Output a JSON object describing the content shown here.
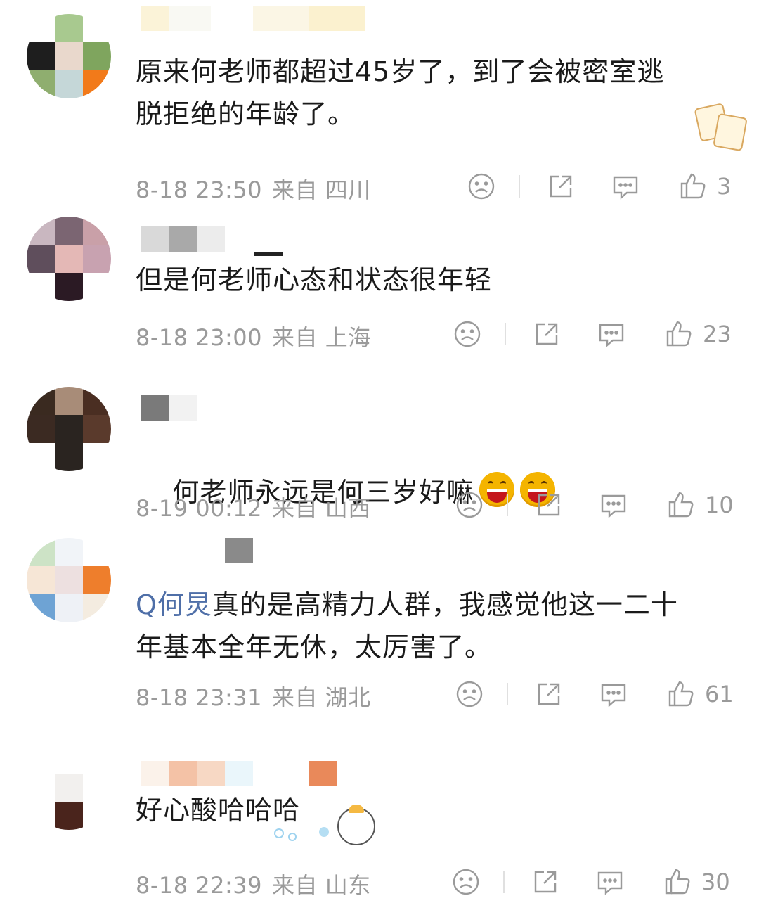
{
  "comments": [
    {
      "text": "原来何老师都超过45岁了，到了会被密室逃\n脱拒绝的年龄了。",
      "time": "8-18 23:50",
      "from": "来自 四川",
      "likes": "3"
    },
    {
      "text": "但是何老师心态和状态很年轻",
      "time": "8-18 23:00",
      "from": "来自 上海",
      "likes": "23"
    },
    {
      "text": "何老师永远是何三岁好嘛",
      "time": "8-19 00:12",
      "from": "来自 山西",
      "likes": "10"
    },
    {
      "mention": "Q何炅",
      "text": "真的是高精力人群，我感觉他这一二十\n年基本全年无休，太厉害了。",
      "time": "8-18 23:31",
      "from": "来自 湖北",
      "likes": "61"
    },
    {
      "text": "好心酸哈哈哈",
      "time": "8-18 22:39",
      "from": "来自 山东",
      "likes": "30"
    }
  ],
  "icons": [
    "dislike-icon",
    "share-icon",
    "reply-icon",
    "like-icon",
    "laugh-emoji",
    "fortune-mahjong-sticker",
    "cartoon-sticker"
  ],
  "colors": {
    "meta_text": "#9a9a9a",
    "mention": "#4f6fa8",
    "divider": "#ececec"
  }
}
